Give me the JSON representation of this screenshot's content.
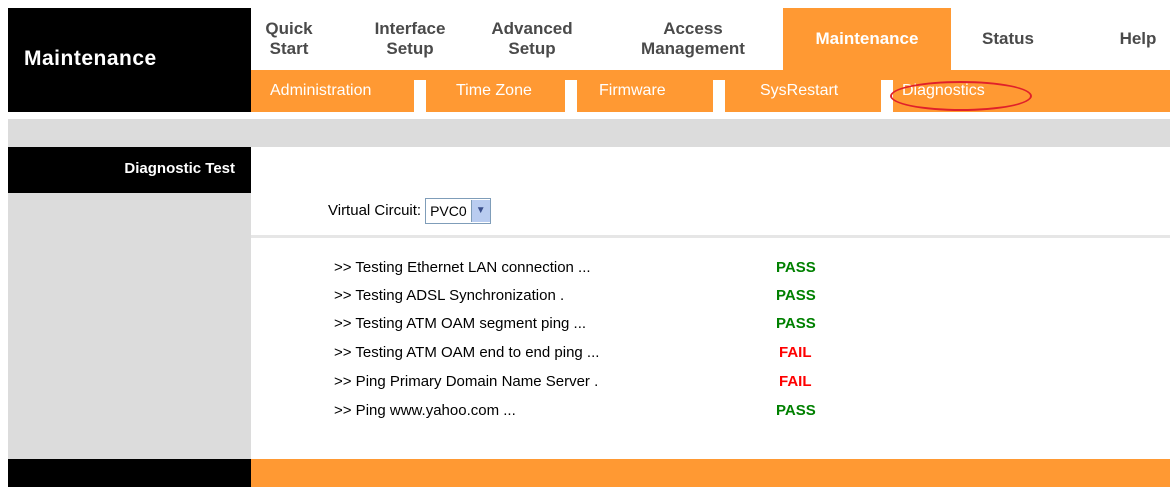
{
  "brand": "Maintenance",
  "nav": [
    {
      "label": "Quick\nStart"
    },
    {
      "label": "Interface\nSetup"
    },
    {
      "label": "Advanced\nSetup"
    },
    {
      "label": "Access\nManagement"
    },
    {
      "label": "Maintenance",
      "active": true
    },
    {
      "label": "Status"
    },
    {
      "label": "Help"
    }
  ],
  "subnav": [
    "Administration",
    "Time Zone",
    "Firmware",
    "SysRestart",
    "Diagnostics"
  ],
  "section_title": "Diagnostic Test",
  "virtual_circuit": {
    "label": "Virtual Circuit:",
    "value": "PVC0"
  },
  "tests": [
    {
      "label": ">> Testing Ethernet LAN connection ...",
      "result": "PASS"
    },
    {
      "label": ">> Testing ADSL Synchronization .",
      "result": "PASS"
    },
    {
      "label": ">> Testing ATM OAM segment ping ...",
      "result": "PASS"
    },
    {
      "label": ">> Testing ATM OAM end to end ping ...",
      "result": "FAIL"
    },
    {
      "label": ">> Ping Primary Domain Name Server .",
      "result": "FAIL"
    },
    {
      "label": ">> Ping www.yahoo.com ...",
      "result": "PASS"
    }
  ],
  "colors": {
    "accent": "#ff9933",
    "pass": "#008000",
    "fail": "#ff0000",
    "highlight": "#e0202a"
  }
}
